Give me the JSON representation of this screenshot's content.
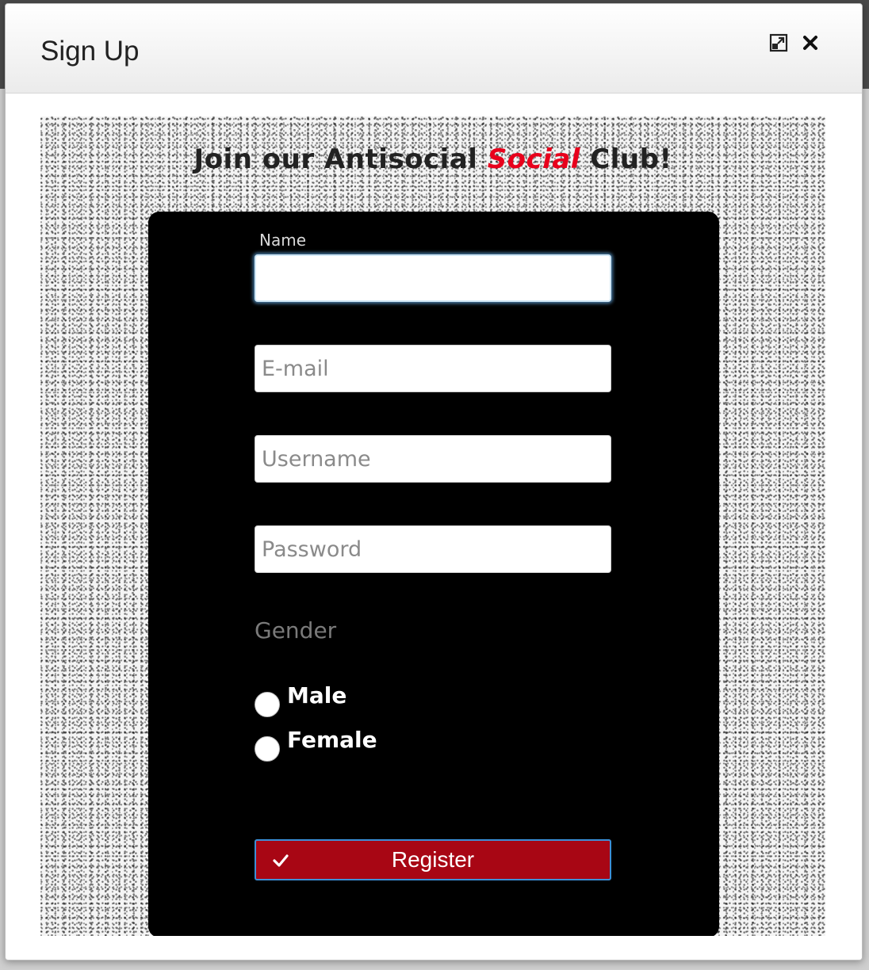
{
  "modal": {
    "title": "Sign Up",
    "maximize_icon": "maximize-icon",
    "close_icon": "close-icon"
  },
  "heading": {
    "before": "Join our Antisocial ",
    "accent": "Social",
    "after": " Club!"
  },
  "form": {
    "name_label": "Name",
    "name_value": "",
    "email_placeholder": "E-mail",
    "username_placeholder": "Username",
    "password_placeholder": "Password",
    "gender_label": "Gender",
    "gender_options": [
      "Male",
      "Female"
    ],
    "register_label": "Register",
    "register_icon": "check-icon"
  },
  "colors": {
    "accent_red": "#e8001c",
    "button_red": "#a80614",
    "card_bg": "#000000"
  }
}
